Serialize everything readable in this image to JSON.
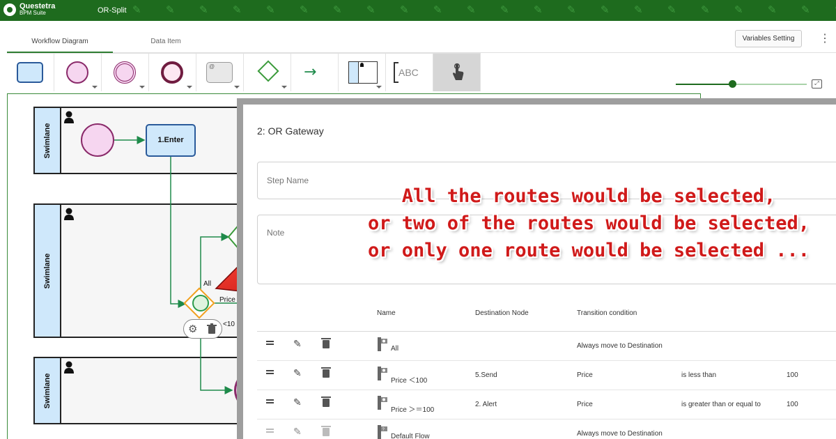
{
  "topbar": {
    "logo_name": "Questetra",
    "logo_sub": "BPM Suite",
    "app_title": "OR-Split",
    "leaf_icon": "✎",
    "brand_color": "#1e6b1e"
  },
  "tabs": [
    {
      "label": "Workflow Diagram",
      "active": true
    },
    {
      "label": "Data Item",
      "active": false
    }
  ],
  "header_actions": {
    "variables_setting_label": "Variables Setting",
    "more_icon": "⋮"
  },
  "palette": {
    "text_tool_label": "ABC",
    "subprocess_marker": "@",
    "arrow_glyph": "→",
    "items": [
      "human-task-tool",
      "start-event-tool",
      "intermediate-event-tool",
      "end-event-tool",
      "subprocess-tool",
      "gateway-tool",
      "flow-arrow-tool",
      "swimlane-tool",
      "text-annotation-tool",
      "pan-tool"
    ]
  },
  "zoom": {
    "level": 0.43
  },
  "diagram": {
    "lanes": [
      {
        "label": "Swimlane"
      },
      {
        "label": "Swimlane"
      },
      {
        "label": "Swimlane"
      }
    ],
    "task_label": "1.Enter",
    "gateway_labels": {
      "all": "All",
      "price": "Price",
      "lt100": "<10"
    },
    "tool_icons": {
      "gear": "⚙"
    }
  },
  "panel": {
    "title": "2: OR Gateway",
    "step_name_placeholder": "Step Name",
    "note_placeholder": "Note",
    "columns": {
      "name": "Name",
      "destination": "Destination Node",
      "condition": "Transition condition"
    },
    "edit_icon": "✎",
    "rows": [
      {
        "name": "All",
        "destination": "",
        "condition": "Always move to Destination",
        "operator": "",
        "value": "",
        "dim": false
      },
      {
        "name": "Price ＜100",
        "destination": "5.Send",
        "condition": "Price",
        "operator": "is less than",
        "value": "100",
        "dim": false
      },
      {
        "name": "Price ＞＝100",
        "destination": "2. Alert",
        "condition": "Price",
        "operator": "is greater than or equal to",
        "value": "100",
        "dim": false
      },
      {
        "name": "Default Flow",
        "destination": "",
        "condition": "Always move to Destination",
        "operator": "",
        "value": "",
        "dim": true
      }
    ]
  },
  "annotation": {
    "line1": "All the routes would be selected,",
    "line2": "or two of the routes would be selected,",
    "line3": "or only one route would be selected ...",
    "color": "#d01a1a"
  }
}
